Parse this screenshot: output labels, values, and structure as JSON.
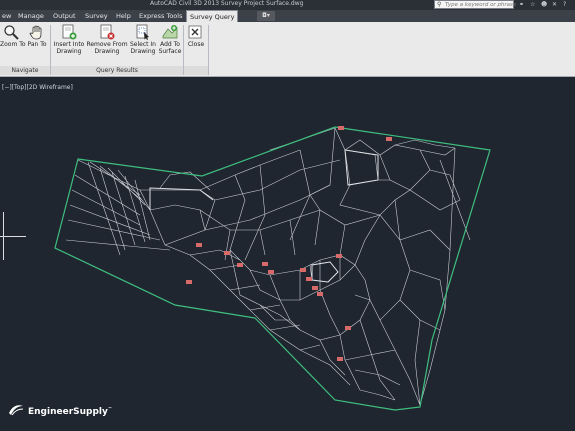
{
  "window": {
    "title": "AutoCAD Civil 3D 2013    Survey Project Surface.dwg",
    "search_placeholder": "Type a keyword or phrase"
  },
  "tabs": [
    {
      "label": "ew"
    },
    {
      "label": "Manage"
    },
    {
      "label": "Output"
    },
    {
      "label": "Survey"
    },
    {
      "label": "Help"
    },
    {
      "label": "Express Tools"
    },
    {
      "label": "Survey Query",
      "active": true
    }
  ],
  "ribbon": {
    "navigate": {
      "panel_label": "Navigate",
      "zoom_to": {
        "line1": "Zoom To",
        "icon": "magnifier-icon"
      },
      "pan_to": {
        "line1": "Pan To",
        "icon": "hand-icon"
      }
    },
    "query_results": {
      "panel_label": "Query Results",
      "insert_into_drawing": {
        "line1": "Insert Into",
        "line2": "Drawing"
      },
      "remove_from_drawing": {
        "line1": "Remove From",
        "line2": "Drawing"
      },
      "select_in_drawing": {
        "line1": "Select In",
        "line2": "Drawing"
      },
      "add_to_surface": {
        "line1": "Add To",
        "line2": "Surface"
      }
    },
    "close": {
      "line1": "Close"
    }
  },
  "viewport": {
    "label": "[−][Top][2D Wireframe]"
  },
  "watermark": {
    "brand": "EngineerSupply",
    "trademark": "™"
  },
  "colors": {
    "viewport_bg": "#1f2630",
    "boundary": "#3fbf7f",
    "mesh": "#c9ccd2",
    "points": "#d86a6a",
    "ribbon_bg": "#eaeaea",
    "tabbar_bg": "#3c4048"
  }
}
